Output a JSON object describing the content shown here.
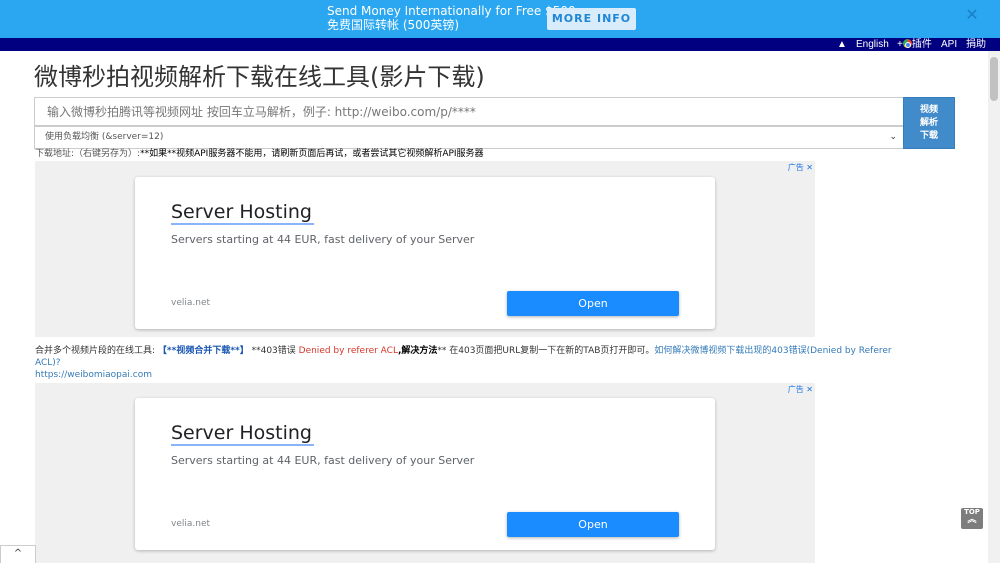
{
  "promo": {
    "line1": "Send Money Internationally for Free $500",
    "line2": "免费国际转帐 (500英镑)",
    "button_label": "MORE INFO ›",
    "close_label": "✕"
  },
  "nav": {
    "up_icon": "▲",
    "english": "English",
    "extension": "插件",
    "extension_prefix": "+",
    "api": "API",
    "donate": "捐助"
  },
  "page": {
    "title": "微博秒拍视频解析下载在线工具(影片下载)"
  },
  "search": {
    "placeholder": "输入微博秒拍腾讯等视频网址 按回车立马解析，例子: http://weibo.com/p/****",
    "value": ""
  },
  "server_select": {
    "selected": "使用负载均衡 (&server=12)",
    "chevron": "⌄"
  },
  "parse_button": {
    "line1": "视频",
    "line2": "解析",
    "line3": "下载"
  },
  "download": {
    "label": "下载地址:（右键另存为）:",
    "note": "**如果**视频API服务器不能用，请刷新页面后再试，或者尝试其它视频解析API服务器"
  },
  "ads": [
    {
      "choice": "广告 ✕",
      "title": "Server Hosting",
      "description": "Servers starting at 44 EUR, fast delivery of your Server",
      "domain": "velia.net",
      "button": "Open"
    },
    {
      "choice": "广告 ✕",
      "title": "Server Hosting",
      "description": "Servers starting at 44 EUR, fast delivery of your Server",
      "domain": "velia.net",
      "button": "Open"
    }
  ],
  "merge": {
    "prefix": "合并多个视频片段的在线工具: ",
    "merge_link": "【**视频合并下载**】",
    "error_text": " **403错误 ",
    "denied": "Denied by referer ACL",
    "solution_label": ",解决方法",
    "solution_text": "** 在403页面把URL复制一下在新的TAB页打开即可。",
    "help_link": "如何解决微博视频下载出现的403错误(Denied by Referer ACL)?",
    "site_link": "https://weibomiaopai.com"
  },
  "top_button": {
    "label": "TOP",
    "chevron": "︽"
  },
  "bottom_tab": {
    "chevron": "^"
  },
  "colors": {
    "promo_bg": "#2aa7f0",
    "nav_bg": "#000080",
    "parse_button_bg": "#428bca",
    "ad_open_bg": "#1a8cff",
    "error_red": "#d9362b",
    "link_blue": "#337ab7"
  }
}
